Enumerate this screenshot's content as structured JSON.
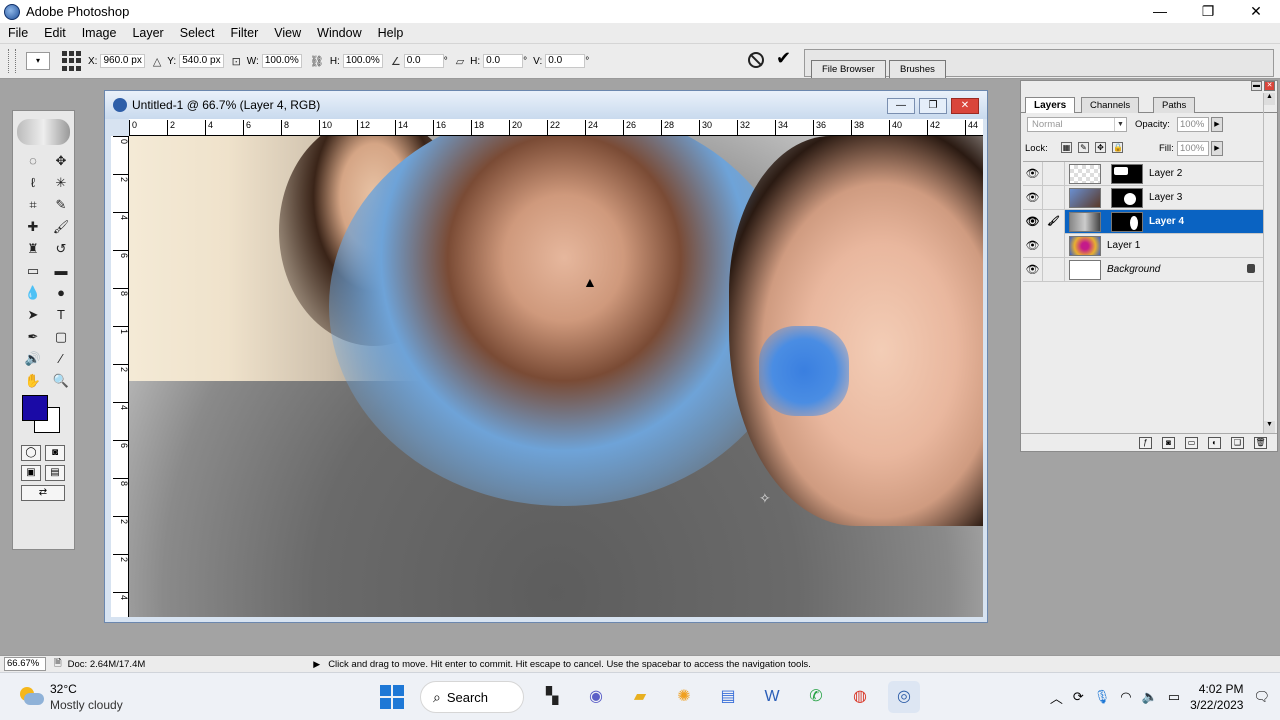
{
  "app": {
    "title": "Adobe Photoshop",
    "min": "—",
    "max": "❐",
    "close": "✕"
  },
  "menu": [
    "File",
    "Edit",
    "Image",
    "Layer",
    "Select",
    "Filter",
    "View",
    "Window",
    "Help"
  ],
  "options": {
    "x_label": "X:",
    "x_value": "960.0 px",
    "y_label": "Y:",
    "y_value": "540.0 px",
    "w_label": "W:",
    "w_value": "100.0%",
    "h_label": "H:",
    "h_value": "100.0%",
    "angle_value": "0.0",
    "skew_h_label": "H:",
    "skew_h_value": "0.0",
    "skew_v_label": "V:",
    "skew_v_value": "0.0",
    "degree": "°"
  },
  "palette_well": {
    "tab1": "File Browser",
    "tab2": "Brushes"
  },
  "document": {
    "title": "Untitled-1 @ 66.7% (Layer 4, RGB)"
  },
  "ruler": {
    "h_ticks": [
      "0",
      "2",
      "4",
      "6",
      "8",
      "10",
      "12",
      "14",
      "16",
      "18",
      "20",
      "22",
      "24",
      "26",
      "28",
      "30",
      "32",
      "34",
      "36",
      "38",
      "40",
      "42",
      "44"
    ],
    "v_ticks": [
      "0",
      "2",
      "4",
      "6",
      "8",
      "1",
      "2",
      "4",
      "6",
      "8",
      "2",
      "2",
      "4"
    ]
  },
  "layers_panel": {
    "tabs": [
      "Layers",
      "Channels",
      "Paths"
    ],
    "blend_mode": "Normal",
    "opacity_label": "Opacity:",
    "opacity_value": "100%",
    "lock_label": "Lock:",
    "fill_label": "Fill:",
    "fill_value": "100%",
    "layers": [
      {
        "name": "Layer 2",
        "selected": false
      },
      {
        "name": "Layer 3",
        "selected": false
      },
      {
        "name": "Layer 4",
        "selected": true
      },
      {
        "name": "Layer 1",
        "selected": false
      },
      {
        "name": "Background",
        "selected": false
      }
    ]
  },
  "status": {
    "zoom": "66.67%",
    "doc": "Doc: 2.64M/17.4M",
    "hint": "Click and drag to move. Hit enter to commit. Hit escape to cancel. Use the spacebar to access the navigation tools."
  },
  "taskbar": {
    "temp": "32°C",
    "condition": "Mostly cloudy",
    "search": "Search",
    "time": "4:02 PM",
    "date": "3/22/2023"
  },
  "colors": {
    "foreground": "#1a0aa6",
    "background": "#ffffff",
    "selection": "#0a63c2"
  }
}
